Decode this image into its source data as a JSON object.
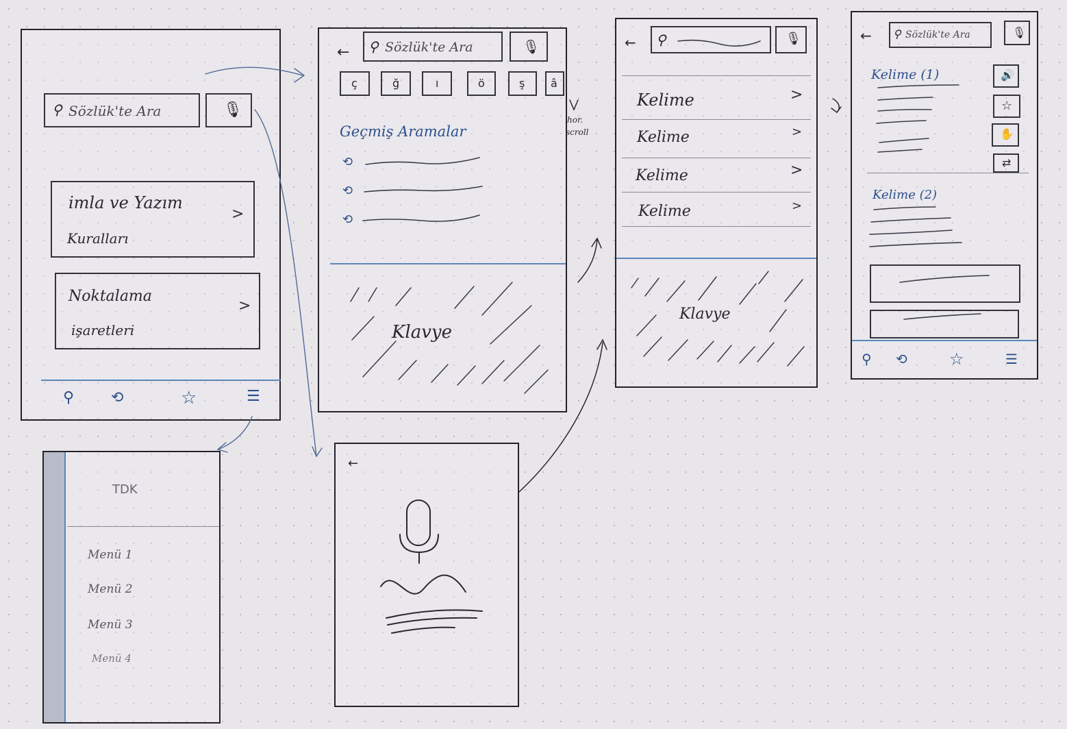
{
  "home": {
    "search_placeholder": "Sözlük'te Ara",
    "cards": [
      {
        "line1": "imla ve Yazım",
        "line2": "Kuralları"
      },
      {
        "line1": "Noktalama",
        "line2": "işaretleri"
      }
    ]
  },
  "search": {
    "placeholder": "Sözlük'te Ara",
    "letters": [
      "ç",
      "ğ",
      "ı",
      "ö",
      "ş",
      "â"
    ],
    "scroll_note_1": "hor.",
    "scroll_note_2": "scroll",
    "history_title": "Geçmiş Aramalar",
    "keyboard_label": "Klavye"
  },
  "results": {
    "items": [
      "Kelime",
      "Kelime",
      "Kelime",
      "Kelime"
    ],
    "keyboard_label": "Klavye"
  },
  "detail": {
    "placeholder": "Sözlük'te Ara",
    "word1": "Kelime (1)",
    "word2": "Kelime (2)"
  },
  "drawer": {
    "title": "TDK",
    "menu": [
      "Menü 1",
      "Menü 2",
      "Menü 3",
      "Menü 4"
    ]
  },
  "icons": {
    "back": "←",
    "search": "🔍",
    "history": "⟲",
    "favorite": "☆",
    "menu": "☰",
    "chevron": ">"
  }
}
